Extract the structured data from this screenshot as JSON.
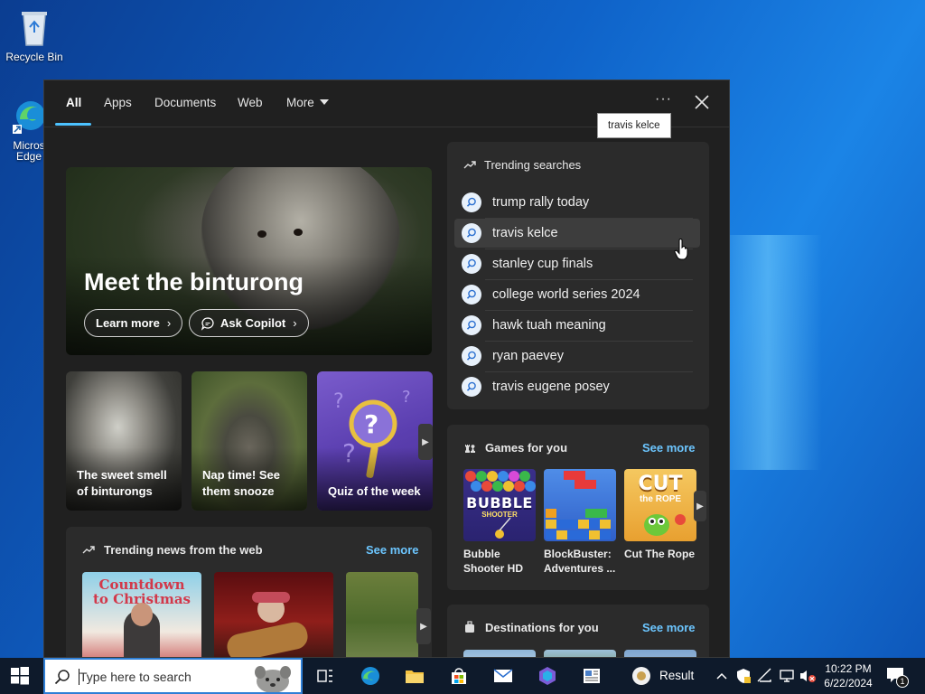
{
  "desktop": {
    "icons": [
      {
        "label": "Recycle Bin",
        "icon": "recycle-bin-icon"
      },
      {
        "label": "Micros",
        "label2": "Edge",
        "icon": "edge-icon"
      }
    ]
  },
  "search_panel": {
    "tabs": [
      {
        "label": "All",
        "active": true
      },
      {
        "label": "Apps"
      },
      {
        "label": "Documents"
      },
      {
        "label": "Web"
      },
      {
        "label": "More"
      }
    ],
    "more_icon": "ellipsis-icon",
    "close_icon": "close-icon",
    "hero": {
      "title": "Meet the binturong",
      "learn_more": "Learn more",
      "ask_copilot": "Ask Copilot"
    },
    "cards": [
      {
        "caption": "The sweet smell of binturongs"
      },
      {
        "caption": "Nap time! See them snooze"
      },
      {
        "caption": "Quiz of the week"
      }
    ],
    "trending_news": {
      "title": "Trending news from the web",
      "see_more": "See more",
      "thumb_text": "Countdown to Christmas"
    },
    "trending_searches": {
      "title": "Trending searches",
      "items": [
        "trump rally today",
        "travis kelce",
        "stanley cup finals",
        "college world series 2024",
        "hawk tuah meaning",
        "ryan paevey",
        "travis eugene posey"
      ],
      "hovered_index": 1,
      "tooltip": "travis kelce"
    },
    "games": {
      "title": "Games for you",
      "see_more": "See more",
      "items": [
        {
          "name": "Bubble Shooter HD",
          "line1": "Bubble",
          "line2": "Shooter HD",
          "tile_text": "BUBBLE",
          "tile_sub": "SHOOTER"
        },
        {
          "name": "BlockBuster: Adventures ...",
          "line1": "BlockBuster:",
          "line2": "Adventures ..."
        },
        {
          "name": "Cut The Rope",
          "line1": "Cut The Rope",
          "line2": "",
          "tile_text": "CUT",
          "tile_sub": "the ROPE"
        }
      ]
    },
    "destinations": {
      "title": "Destinations for you",
      "see_more": "See more"
    }
  },
  "taskbar": {
    "search_placeholder": "Type here to search",
    "result_label": "Result",
    "time": "10:22 PM",
    "date": "6/22/2024",
    "notification_count": "1",
    "colors": {
      "accent": "#4cc2ff",
      "link": "#6cc6ff",
      "panel": "#202020",
      "taskbar": "#0e1a2b"
    }
  }
}
